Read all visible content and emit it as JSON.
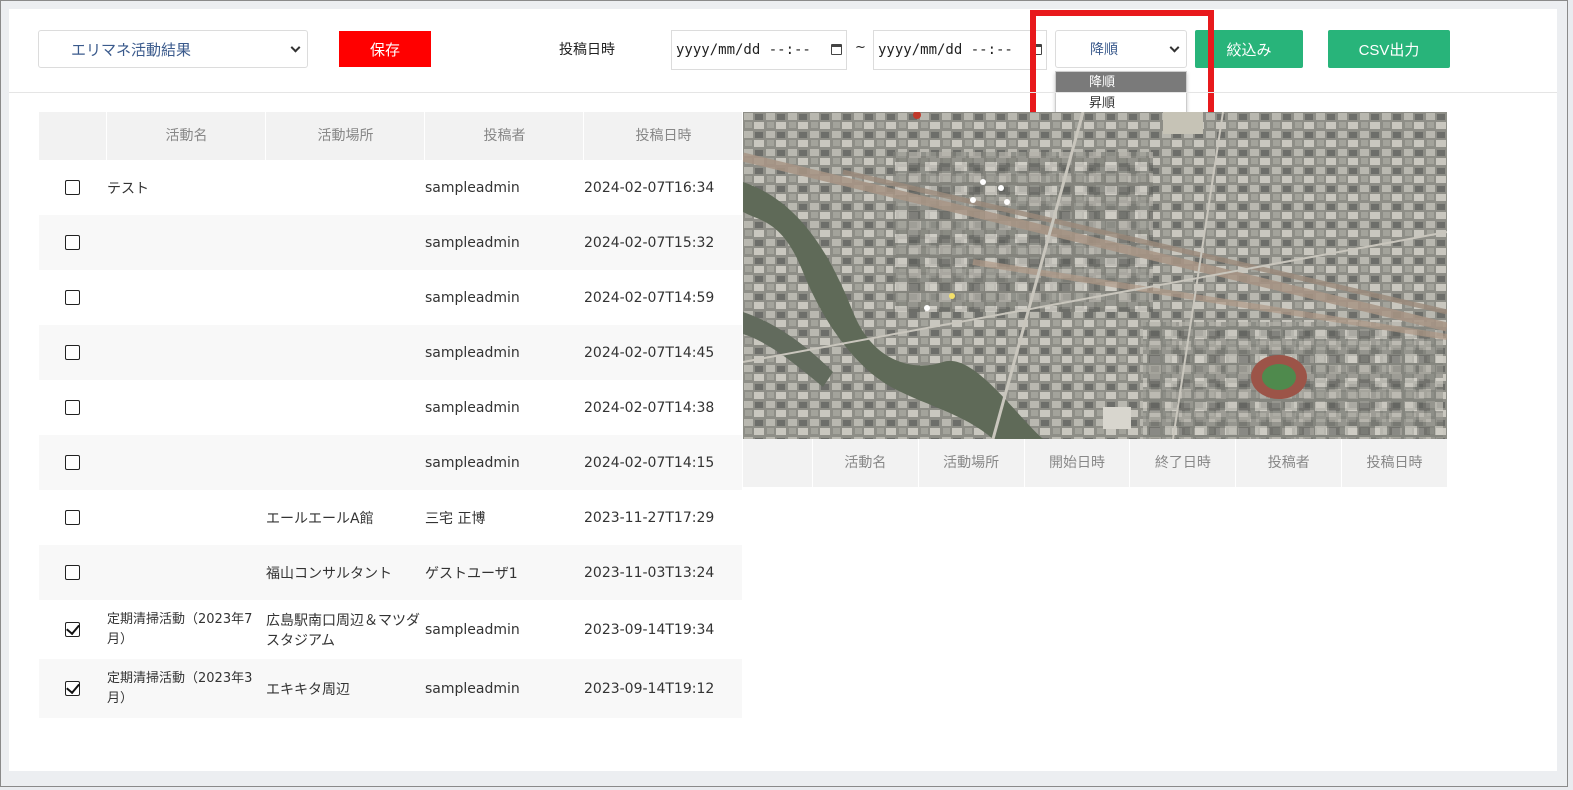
{
  "toolbar": {
    "view_select": "エリマネ活動結果",
    "save_label": "保存",
    "posted_label": "投稿日時",
    "date_from_placeholder": "yyyy/mm/dd --:--",
    "date_to_placeholder": "yyyy/mm/dd --:--",
    "range_separator": "~",
    "sort_select": "降順",
    "sort_options": [
      "降順",
      "昇順"
    ],
    "filter_label": "絞込み",
    "csv_label": "CSV出力"
  },
  "left_table": {
    "headers": [
      "活動名",
      "活動場所",
      "投稿者",
      "投稿日時"
    ],
    "rows": [
      {
        "checked": false,
        "name": "テスト",
        "place": "",
        "poster": "sampleadmin",
        "date": "2024-02-07T16:34"
      },
      {
        "checked": false,
        "name": "",
        "place": "",
        "poster": "sampleadmin",
        "date": "2024-02-07T15:32"
      },
      {
        "checked": false,
        "name": "",
        "place": "",
        "poster": "sampleadmin",
        "date": "2024-02-07T14:59"
      },
      {
        "checked": false,
        "name": "",
        "place": "",
        "poster": "sampleadmin",
        "date": "2024-02-07T14:45"
      },
      {
        "checked": false,
        "name": "",
        "place": "",
        "poster": "sampleadmin",
        "date": "2024-02-07T14:38"
      },
      {
        "checked": false,
        "name": "",
        "place": "",
        "poster": "sampleadmin",
        "date": "2024-02-07T14:15"
      },
      {
        "checked": false,
        "name": "",
        "place": "エールエールA館",
        "poster": "三宅 正博",
        "date": "2023-11-27T17:29"
      },
      {
        "checked": false,
        "name": "",
        "place": "福山コンサルタント",
        "poster": "ゲストユーザ1",
        "date": "2023-11-03T13:24"
      },
      {
        "checked": true,
        "name": "定期清掃活動（2023年7月）",
        "place": "広島駅南口周辺＆マツダスタジアム",
        "poster": "sampleadmin",
        "date": "2023-09-14T19:34"
      },
      {
        "checked": true,
        "name": "定期清掃活動（2023年3月）",
        "place": "エキキタ周辺",
        "poster": "sampleadmin",
        "date": "2023-09-14T19:12"
      }
    ]
  },
  "right_table": {
    "headers": [
      "活動名",
      "活動場所",
      "開始日時",
      "終了日時",
      "投稿者",
      "投稿日時"
    ]
  },
  "colors": {
    "save": "#ff0000",
    "green": "#28b47a",
    "highlight": "#e8191c"
  }
}
